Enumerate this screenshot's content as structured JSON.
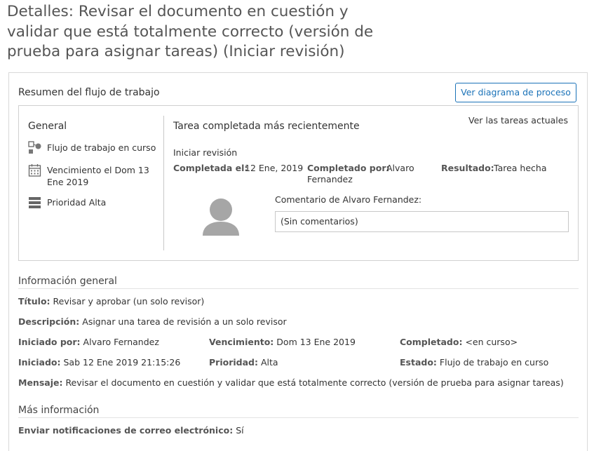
{
  "page": {
    "title": "Detalles: Revisar el documento en cuestión y validar que está totalmente correcto (versión de prueba para asignar tareas) (Iniciar revisión)"
  },
  "summary": {
    "title": "Resumen del flujo de trabajo",
    "diagram_button": "Ver diagrama de proceso",
    "general": {
      "heading": "General",
      "workflow_status": "Flujo de trabajo en curso",
      "due": "Vencimiento el Dom 13 Ene 2019",
      "priority": "Prioridad Alta"
    },
    "recent": {
      "heading": "Tarea completada más recientemente",
      "current_tasks_link": "Ver las tareas actuales",
      "task_name": "Iniciar revisión",
      "completed_on_label": "Completada el:",
      "completed_on_value": "12 Ene, 2019",
      "completed_by_label": "Completado por:",
      "completed_by_value": "Alvaro Fernandez",
      "result_label": "Resultado:",
      "result_value": "Tarea hecha",
      "comment_label": "Comentario de Alvaro Fernandez:",
      "comment_value": "(Sin comentarios)"
    }
  },
  "general_info": {
    "heading": "Información general",
    "title_label": "Título:",
    "title_value": "Revisar y aprobar (un solo revisor)",
    "description_label": "Descripción:",
    "description_value": "Asignar una tarea de revisión a un solo revisor",
    "started_by_label": "Iniciado por:",
    "started_by_value": "Alvaro Fernandez",
    "due_label": "Vencimiento:",
    "due_value": "Dom 13 Ene 2019",
    "completed_label": "Completado:",
    "completed_value": "<en curso>",
    "started_label": "Iniciado:",
    "started_value": "Sab 12 Ene 2019 21:15:26",
    "priority_label": "Prioridad:",
    "priority_value": "Alta",
    "status_label": "Estado:",
    "status_value": "Flujo de trabajo en curso",
    "message_label": "Mensaje:",
    "message_value": "Revisar el documento en cuestión y validar que está totalmente correcto (versión de prueba para asignar tareas)"
  },
  "more_info": {
    "heading": "Más información",
    "notifications_label": "Enviar notificaciones de correo electrónico:",
    "notifications_value": "Sí"
  },
  "icons": {
    "workflow": "workflow-icon",
    "calendar": "calendar-icon",
    "priority": "priority-icon",
    "avatar": "user-avatar-icon"
  },
  "colors": {
    "accent": "#1a72b8",
    "title_text": "#555555"
  }
}
